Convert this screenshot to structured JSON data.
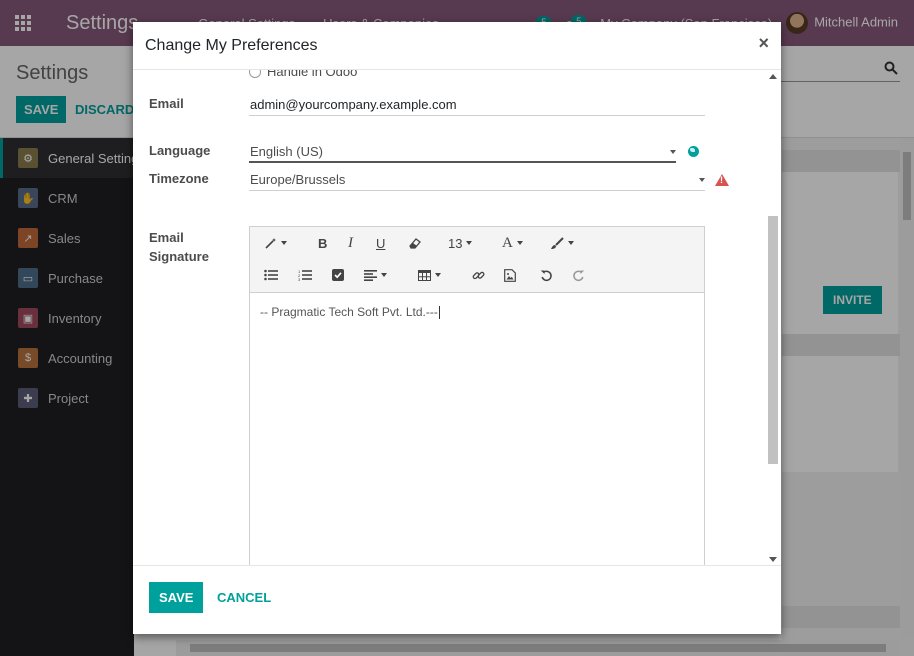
{
  "topbar": {
    "app_title": "Settings",
    "menu": [
      "General Settings",
      "Users & Companies"
    ],
    "activity_count": "5",
    "message_count": "5",
    "company": "My Company (San Francisco)",
    "user": "Mitchell Admin"
  },
  "control_panel": {
    "title": "Settings",
    "save_label": "SAVE",
    "discard_label": "DISCARD"
  },
  "sidebar": {
    "items": [
      {
        "label": "General Settings",
        "icon": "gear-icon",
        "color": "#8a7d4f",
        "active": true
      },
      {
        "label": "CRM",
        "icon": "handshake-icon",
        "color": "#5a6e8c"
      },
      {
        "label": "Sales",
        "icon": "chart-icon",
        "color": "#c0693a"
      },
      {
        "label": "Purchase",
        "icon": "card-icon",
        "color": "#4d6e8a"
      },
      {
        "label": "Inventory",
        "icon": "box-icon",
        "color": "#a04a5c"
      },
      {
        "label": "Accounting",
        "icon": "dollar-doc-icon",
        "color": "#b7733c"
      },
      {
        "label": "Project",
        "icon": "puzzle-icon",
        "color": "#5b5f7a"
      }
    ]
  },
  "background": {
    "invite_label": "INVITE"
  },
  "modal": {
    "title": "Change My Preferences",
    "close_glyph": "×",
    "notification_option": "Handle in Odoo",
    "email": {
      "label": "Email",
      "value": "admin@yourcompany.example.com"
    },
    "language": {
      "label": "Language",
      "value": "English (US)"
    },
    "timezone": {
      "label": "Timezone",
      "value": "Europe/Brussels"
    },
    "signature": {
      "label_line1": "Email",
      "label_line2": "Signature",
      "font_size": "13",
      "content": "-- Pragmatic Tech Soft Pvt. Ltd.---"
    },
    "save_label": "SAVE",
    "cancel_label": "CANCEL"
  },
  "colors": {
    "brand": "#875a7b",
    "accent": "#00a09d",
    "warning": "#d9534f"
  }
}
